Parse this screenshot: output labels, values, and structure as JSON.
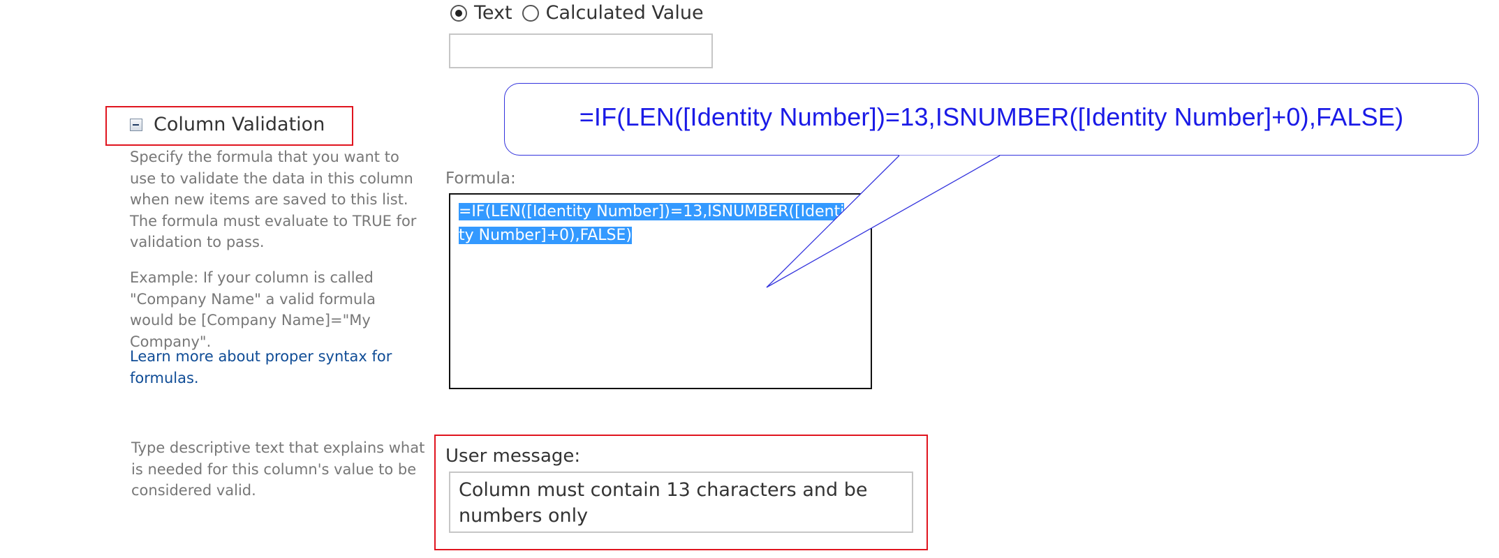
{
  "return_type": {
    "options": [
      {
        "label": "Text",
        "selected": true
      },
      {
        "label": "Calculated Value",
        "selected": false
      }
    ],
    "default_value": ""
  },
  "section": {
    "title": "Column Validation",
    "icon": "collapse-icon"
  },
  "formula": {
    "description": "Specify the formula that you want to use to validate the data in this column when new items are saved to this list. The formula must evaluate to TRUE for validation to pass.",
    "example": "Example: If your column is called \"Company Name\" a valid formula would be [Company Name]=\"My Company\".",
    "learn_more_link": "Learn more about proper syntax for formulas.",
    "label": "Formula:",
    "value": "=IF(LEN([Identity Number])=13,ISNUMBER([Identity Number]+0),FALSE)"
  },
  "callout": {
    "text": "=IF(LEN([Identity Number])=13,ISNUMBER([Identity Number]+0),FALSE)"
  },
  "user_message": {
    "description": "Type descriptive text that explains what is needed for this column's value to be considered valid.",
    "label": "User message:",
    "value": "Column must contain 13 characters and be numbers only"
  },
  "colors": {
    "highlight_border": "#e0141e",
    "callout_text": "#1a1ae6",
    "selection": "#3399ff",
    "link": "#0f4c96"
  }
}
